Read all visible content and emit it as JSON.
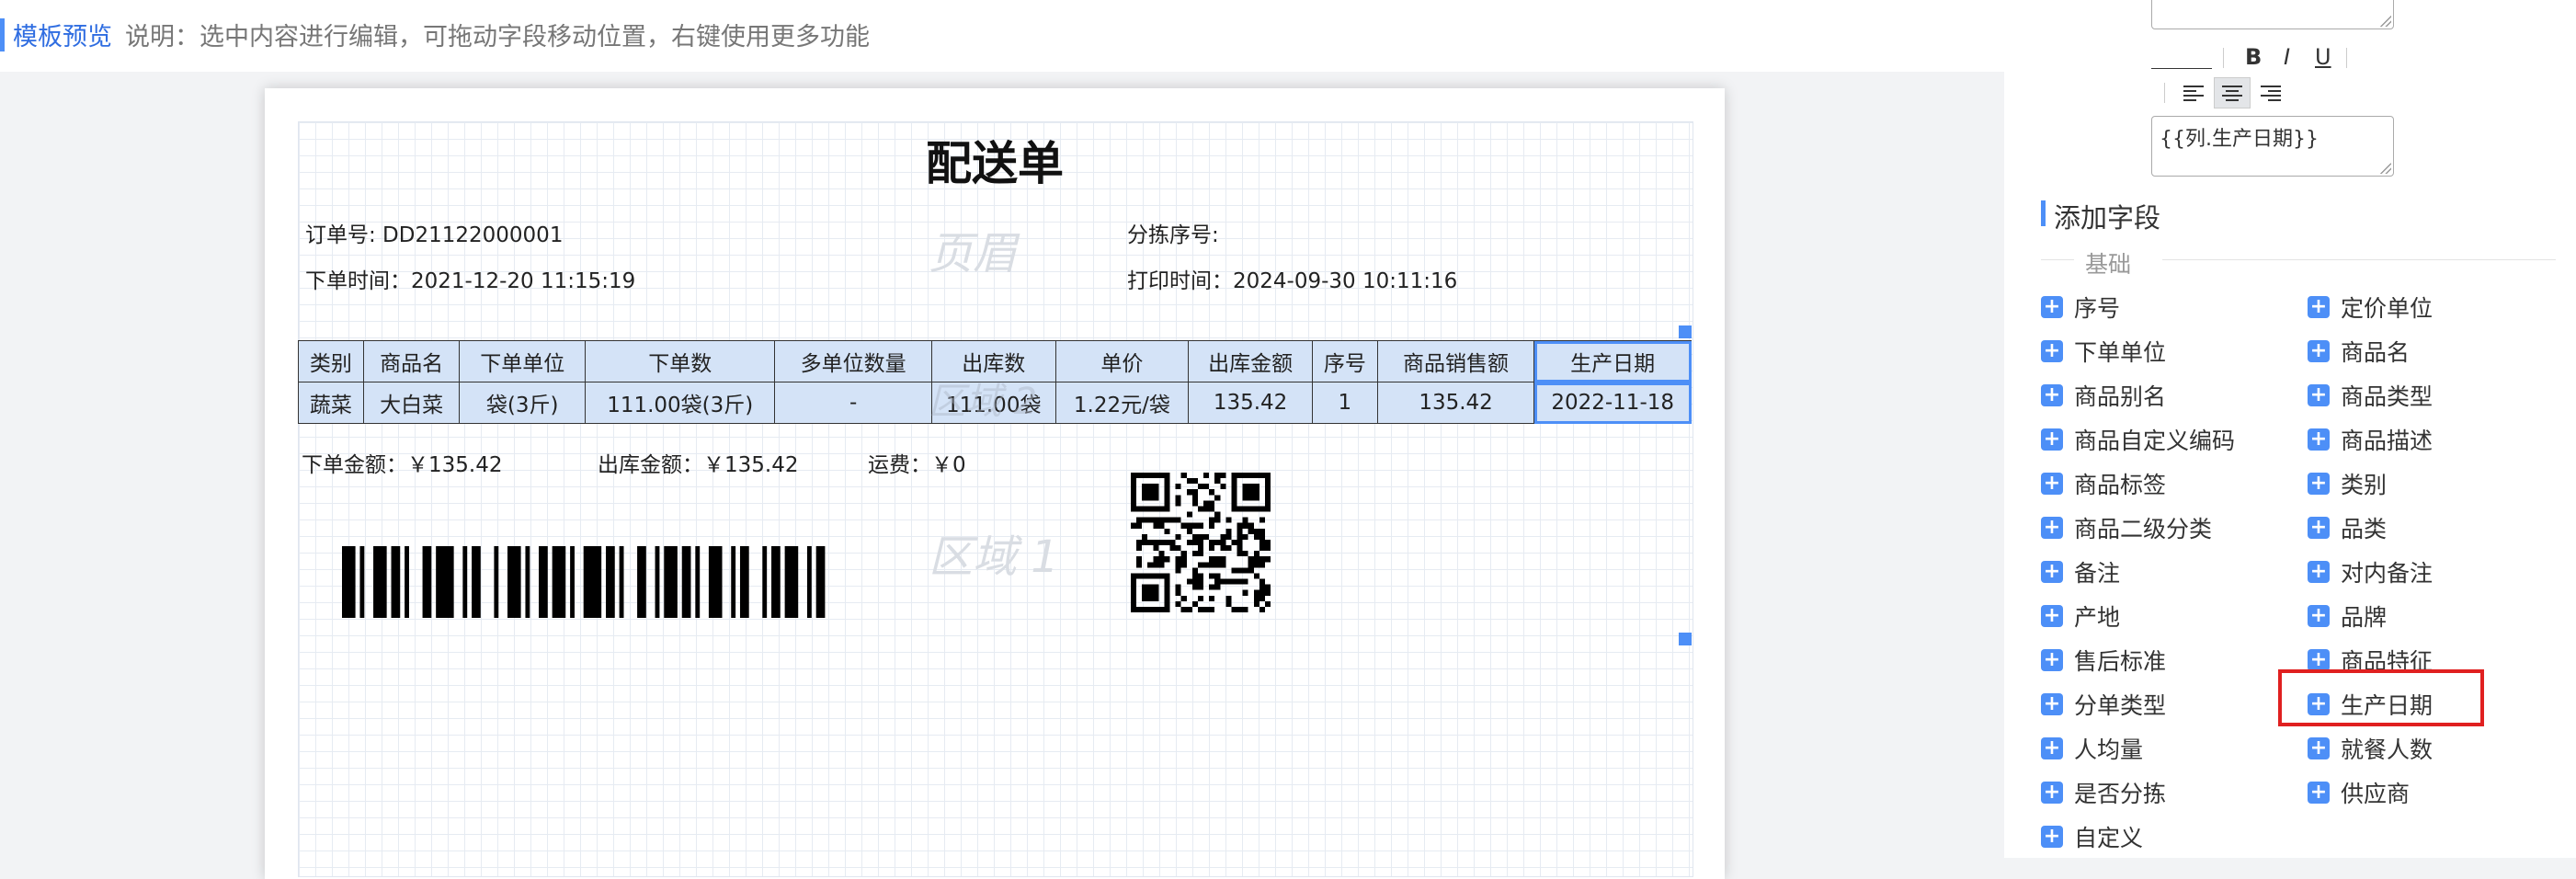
{
  "header": {
    "title": "模板预览",
    "description": "说明：选中内容进行编辑，可拖动字段移动位置，右键使用更多功能"
  },
  "doc": {
    "title": "配送单",
    "order_no": "订单号: DD21122000001",
    "sort_no": "分拣序号:",
    "order_time": "下单时间：2021-12-20 11:15:19",
    "print_time": "打印时间：2024-09-30 10:11:16",
    "ghost_header": "页眉",
    "ghost_area": "区域 1",
    "ghost_table": "区域 2",
    "table": {
      "columns": [
        "类别",
        "商品名",
        "下单单位",
        "下单数",
        "多单位数量",
        "出库数",
        "单价",
        "出库金额",
        "序号",
        "商品销售额",
        "生产日期"
      ],
      "rows": [
        [
          "蔬菜",
          "大白菜",
          "袋(3斤)",
          "111.00袋(3斤)",
          "-",
          "111.00袋",
          "1.22元/袋",
          "135.42",
          "1",
          "135.42",
          "2022-11-18"
        ]
      ]
    },
    "order_amount": "下单金额：￥135.42",
    "out_amount": "出库金额：￥135.42",
    "freight": "运费：￥0"
  },
  "panel": {
    "format": {
      "bold": "B",
      "italic": "I",
      "underline": "U"
    },
    "expression": "{{列.生产日期}}",
    "section_title": "添加字段",
    "group_label": "基础",
    "fields_left": [
      "序号",
      "下单单位",
      "商品别名",
      "商品自定义编码",
      "商品标签",
      "商品二级分类",
      "备注",
      "产地",
      "售后标准",
      "分单类型",
      "人均量",
      "是否分拣",
      "自定义"
    ],
    "fields_right": [
      "定价单位",
      "商品名",
      "商品类型",
      "商品描述",
      "类别",
      "品类",
      "对内备注",
      "品牌",
      "商品特征",
      "生产日期",
      "就餐人数",
      "供应商"
    ]
  },
  "colors": {
    "accent": "#4d8ff7",
    "table_selected": "#d4e3f7",
    "highlight_box": "#e02020"
  }
}
